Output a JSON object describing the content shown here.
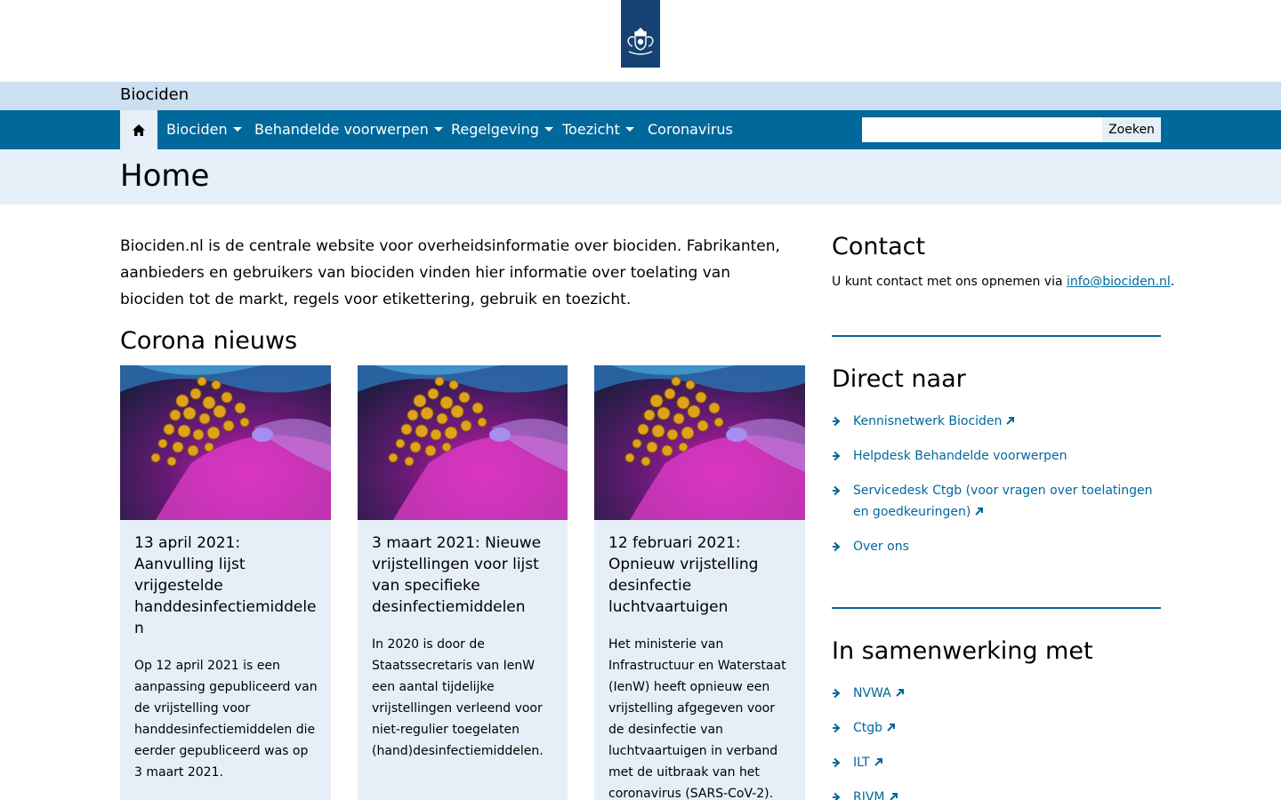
{
  "header": {
    "site_title": "Biociden"
  },
  "nav": {
    "items": [
      {
        "label": "Biociden",
        "has_dropdown": true
      },
      {
        "label": "Behandelde voorwerpen",
        "has_dropdown": true
      },
      {
        "label": "Regelgeving",
        "has_dropdown": true
      },
      {
        "label": "Toezicht",
        "has_dropdown": true
      },
      {
        "label": "Coronavirus",
        "has_dropdown": false
      }
    ],
    "search": {
      "value": "",
      "button_label": "Zoeken"
    }
  },
  "page": {
    "title": "Home",
    "intro": "Biociden.nl is de centrale website voor overheidsinformatie over biociden. Fabrikanten, aanbieders en gebruikers van biociden vinden hier informatie over toelating van biociden tot de markt, regels voor etikettering, gebruik en toezicht."
  },
  "news": {
    "heading": "Corona nieuws",
    "cards": [
      {
        "title": "13 april 2021:  Aanvulling lijst vrijgestelde handdesinfectiemiddelen",
        "text": "Op 12 april 2021 is een aanpassing gepubliceerd van de vrijstelling voor handdesinfectiemiddelen die eerder gepubliceerd was op 3 maart 2021."
      },
      {
        "title": "3 maart 2021: Nieuwe vrijstellingen voor lijst van specifieke desinfectiemiddelen",
        "text": "In 2020 is door de Staatssecretaris van IenW een aantal tijdelijke vrijstellingen verleend voor niet-regulier toegelaten (hand)desinfectiemiddelen."
      },
      {
        "title": "12 februari 2021:  Opnieuw vrijstelling desinfectie luchtvaartuigen",
        "text": "Het ministerie van Infrastructuur en Waterstaat (IenW) heeft opnieuw een vrijstelling afgegeven voor de desinfectie van luchtvaartuigen in verband met de uitbraak van het coronavirus (SARS-CoV-2)."
      }
    ]
  },
  "sidebar": {
    "contact": {
      "heading": "Contact",
      "text_before": "U kunt contact met ons opnemen via ",
      "email": "info@biociden.nl",
      "text_after": "."
    },
    "direct": {
      "heading": "Direct naar",
      "links": [
        {
          "label": "Kennisnetwerk Biociden",
          "external": true
        },
        {
          "label": "Helpdesk Behandelde voorwerpen",
          "external": false
        },
        {
          "label": "Servicedesk Ctgb (voor vragen over toelatingen en goedkeuringen)",
          "external": true
        },
        {
          "label": "Over ons",
          "external": false
        }
      ]
    },
    "partners": {
      "heading": "In samenwerking met",
      "links": [
        {
          "label": "NVWA",
          "external": true
        },
        {
          "label": "Ctgb",
          "external": true
        },
        {
          "label": "ILT",
          "external": true
        },
        {
          "label": "RIVM",
          "external": true
        }
      ]
    }
  },
  "colors": {
    "primary": "#01689b",
    "logo_blue": "#154273",
    "light_blue": "#cce0f1",
    "pale_blue": "#e6eff7"
  },
  "icons": {
    "home": "home-icon",
    "link_arrow": "arrow-right-icon",
    "external": "external-link-icon",
    "caret": "caret-down-icon"
  }
}
